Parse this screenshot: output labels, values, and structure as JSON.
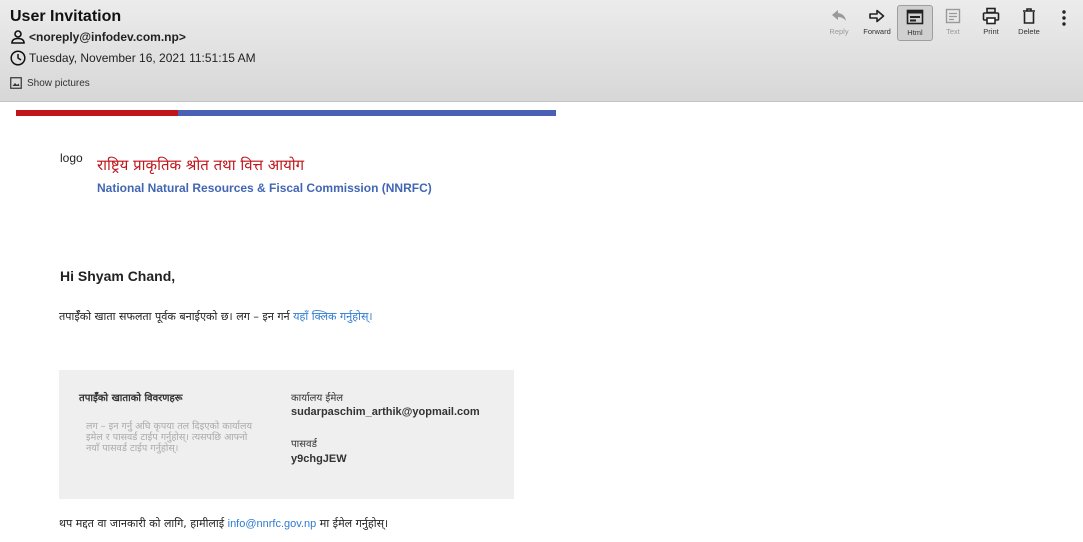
{
  "email": {
    "subject": "User Invitation",
    "from": "<noreply@infodev.com.np>",
    "date": "Tuesday, November 16, 2021 11:51:15 AM",
    "show_pictures": "Show pictures"
  },
  "toolbar": {
    "reply": "Reply",
    "forward": "Forward",
    "html": "Html",
    "text": "Text",
    "print": "Print",
    "delete": "Delete"
  },
  "body": {
    "logo_alt": "logo",
    "org_name_ne": "राष्ट्रिय प्राकृतिक श्रोत तथा वित्त आयोग",
    "org_name_en": "National Natural Resources & Fiscal Commission (NNRFC)",
    "greeting": "Hi Shyam Chand,",
    "intro_text": "तपाईँको खाता सफलता पूर्वक बनाईएको छ। लग – इन गर्न ",
    "intro_link": "यहाँ क्लिक गर्नुहोस्।",
    "card": {
      "title": "तपाईँको खाताको विवरणहरू",
      "note": "लग – इन गर्नु अघि कृपया तल दिइएको कार्यालय इमेल र पासवर्ड टाईप गर्नुहोस्। त्यसपछि आफ्नो नयाँ पासवर्ड टाईप गर्नुहोस्।",
      "email_label": "कार्यालय ईमेल",
      "email_value": "sudarpaschim_arthik@yopmail.com",
      "password_label": "पासवर्ड",
      "password_value": "y9chgJEW"
    },
    "footer_text": "थप मद्दत वा जानकारी को लागि, हामीलाई ",
    "footer_link": "info@nnrfc.gov.np",
    "footer_suffix": " मा ईमेल गर्नुहोस्।"
  },
  "colors": {
    "accent_red": "#c0151b",
    "accent_blue": "#4a5fb6",
    "link": "#2e7bd1"
  }
}
